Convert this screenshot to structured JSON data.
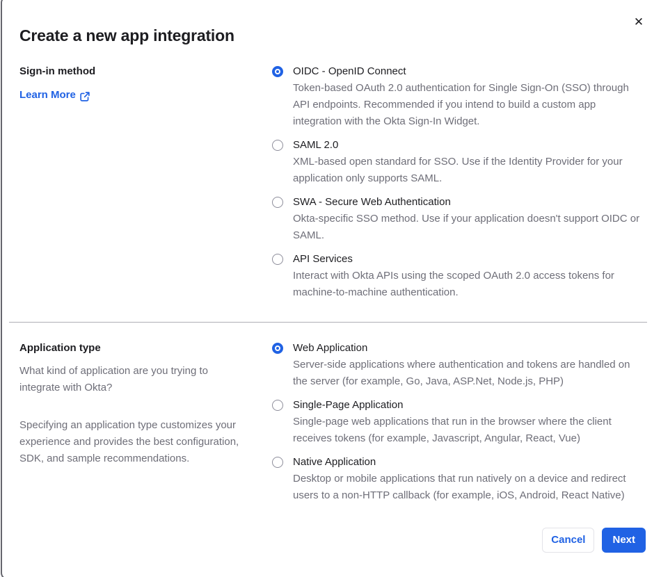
{
  "modal": {
    "title": "Create a new app integration",
    "close_icon": "✕"
  },
  "signin_section": {
    "label": "Sign-in method",
    "learn_more_label": "Learn More",
    "options": [
      {
        "label": "OIDC - OpenID Connect",
        "description": "Token-based OAuth 2.0 authentication for Single Sign-On (SSO) through API endpoints. Recommended if you intend to build a custom app integration with the Okta Sign-In Widget.",
        "selected": true
      },
      {
        "label": "SAML 2.0",
        "description": "XML-based open standard for SSO. Use if the Identity Provider for your application only supports SAML.",
        "selected": false
      },
      {
        "label": "SWA - Secure Web Authentication",
        "description": "Okta-specific SSO method. Use if your application doesn't support OIDC or SAML.",
        "selected": false
      },
      {
        "label": "API Services",
        "description": "Interact with Okta APIs using the scoped OAuth 2.0 access tokens for machine-to-machine authentication.",
        "selected": false
      }
    ]
  },
  "apptype_section": {
    "label": "Application type",
    "paragraph_1": "What kind of application are you trying to integrate with Okta?",
    "paragraph_2": "Specifying an application type customizes your experience and provides the best configuration, SDK, and sample recommendations.",
    "options": [
      {
        "label": "Web Application",
        "description": "Server-side applications where authentication and tokens are handled on the server (for example, Go, Java, ASP.Net, Node.js, PHP)",
        "selected": true
      },
      {
        "label": "Single-Page Application",
        "description": "Single-page web applications that run in the browser where the client receives tokens (for example, Javascript, Angular, React, Vue)",
        "selected": false
      },
      {
        "label": "Native Application",
        "description": "Desktop or mobile applications that run natively on a device and redirect users to a non-HTTP callback (for example, iOS, Android, React Native)",
        "selected": false
      }
    ]
  },
  "footer": {
    "cancel_label": "Cancel",
    "next_label": "Next"
  },
  "colors": {
    "accent_blue": "#2062e4",
    "text_dark": "#1d1d21",
    "text_gray": "#6e6e78",
    "divider_gray": "#aeaeb5",
    "radio_border_gray": "#8d8d9a",
    "cancel_border_gray": "#e3e3e8",
    "modal_border_gray": "#65656d"
  }
}
